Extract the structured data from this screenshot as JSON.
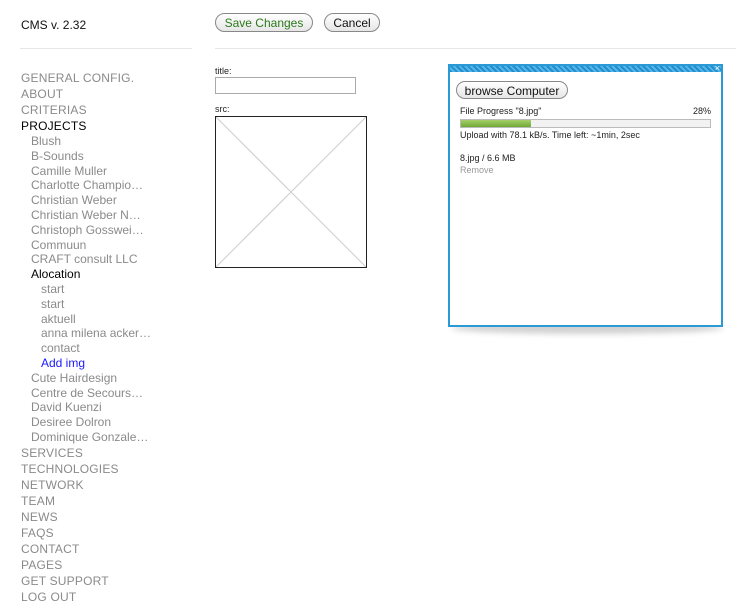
{
  "app": {
    "title": "CMS v. 2.32"
  },
  "toolbar": {
    "save_label": "Save Changes",
    "cancel_label": "Cancel"
  },
  "nav": {
    "general": "GENERAL CONFIG.",
    "about": "ABOUT",
    "criterias": "CRITERIAS",
    "projects": "PROJECTS",
    "projects_items": [
      "Blush",
      "B-Sounds",
      "Camille Muller",
      "Charlotte Champio…",
      "Christian Weber",
      "Christian Weber N…",
      "Christoph Gosswei…",
      "Commuun",
      "CRAFT consult LLC",
      "Alocation"
    ],
    "alocation_children": [
      "start",
      "start",
      "aktuell",
      "anna milena acker…",
      "contact",
      "Add img"
    ],
    "projects_items_after": [
      "Cute Hairdesign",
      "Centre de Secours…",
      "David Kuenzi",
      "Desiree Dolron",
      "Dominique Gonzale…"
    ],
    "bottom": [
      "SERVICES",
      "TECHNOLOGIES",
      "NETWORK",
      "TEAM",
      "NEWS",
      "FAQS",
      "CONTACT",
      "PAGES",
      "GET SUPPORT",
      "LOG OUT"
    ]
  },
  "form": {
    "title_label": "title:",
    "title_value": "",
    "src_label": "src:"
  },
  "upload": {
    "browse_label": "browse Computer",
    "progress_label": "File Progress \"8.jpg\"",
    "progress_percent": "28%",
    "progress_value": 28,
    "status": "Upload with 78.1 kB/s. Time left: ~1min, 2sec",
    "file_info": "8.jpg / 6.6 MB",
    "remove_label": "Remove",
    "close_glyph": "×",
    "accent_color": "#2a9ad6",
    "fill_color": "#8cc152"
  }
}
